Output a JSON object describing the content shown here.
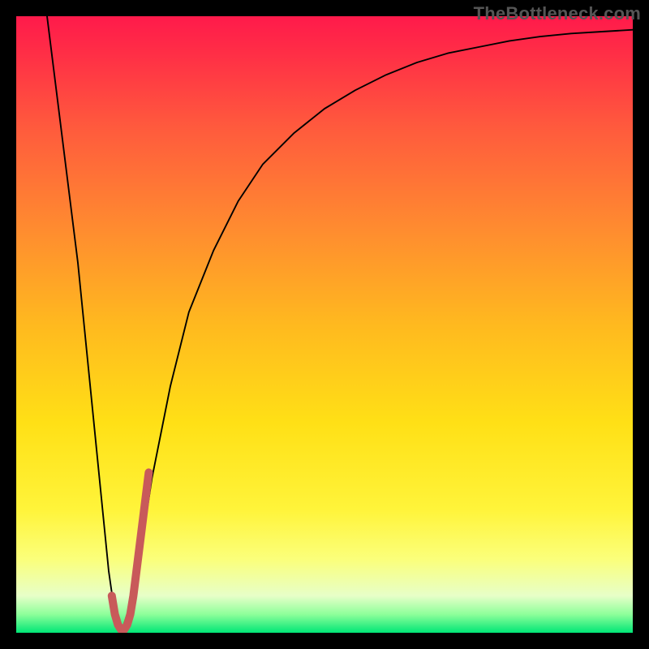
{
  "watermark": "TheBottleneck.com",
  "colors": {
    "frame": "#000000",
    "curve": "#000000",
    "marker": "#c85a5a",
    "gradient_top": "#ff1a4b",
    "gradient_bottom": "#00e676"
  },
  "chart_data": {
    "type": "line",
    "title": "",
    "xlabel": "",
    "ylabel": "",
    "xlim": [
      0,
      100
    ],
    "ylim": [
      0,
      100
    ],
    "gradient_axis": "y",
    "gradient_meaning": "top=red (high bottleneck), bottom=green (low bottleneck)",
    "series": [
      {
        "name": "bottleneck-curve",
        "color": "#000000",
        "x": [
          5,
          10,
          13,
          15,
          16,
          17,
          18,
          20,
          22,
          25,
          28,
          32,
          36,
          40,
          45,
          50,
          55,
          60,
          65,
          70,
          75,
          80,
          85,
          90,
          95,
          100
        ],
        "y": [
          100,
          60,
          30,
          10,
          3,
          0,
          3,
          12,
          25,
          40,
          52,
          62,
          70,
          76,
          81,
          85,
          88,
          90.5,
          92.5,
          94,
          95,
          96,
          96.7,
          97.2,
          97.5,
          97.8
        ]
      },
      {
        "name": "highlight-marker",
        "color": "#c85a5a",
        "shape": "J",
        "x": [
          15.5,
          16,
          16.5,
          17,
          17.5,
          18,
          18.5,
          19,
          19.5,
          20,
          20.5,
          21,
          21.5
        ],
        "y": [
          6,
          3,
          1.3,
          0.5,
          0.5,
          1.3,
          3,
          6,
          10,
          14,
          18,
          22,
          26
        ]
      }
    ],
    "annotations": [
      {
        "text": "TheBottleneck.com",
        "position": "top-right"
      }
    ]
  }
}
